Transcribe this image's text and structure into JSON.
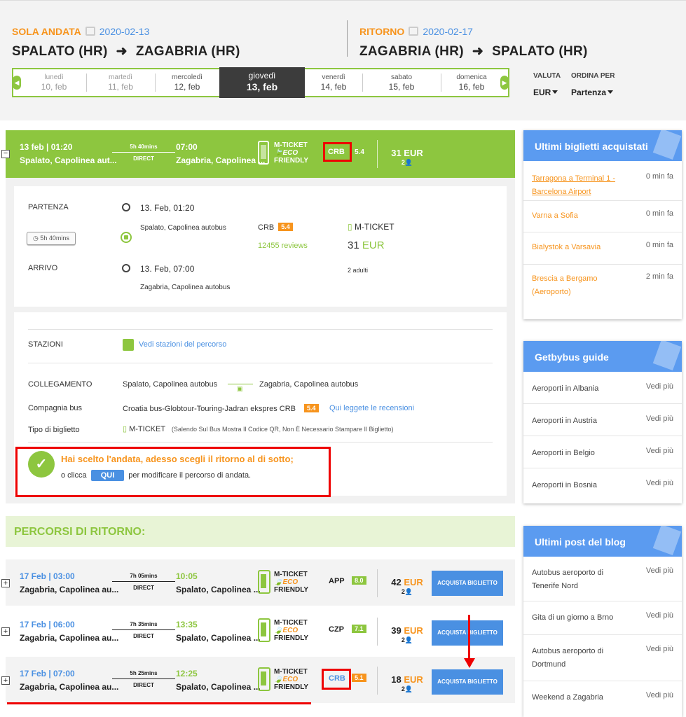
{
  "header": {
    "outbound": {
      "label": "SOLA ANDATA",
      "date": "2020-02-13",
      "from": "SPALATO (HR)",
      "to": "ZAGABRIA (HR)"
    },
    "return": {
      "label": "RITORNO",
      "date": "2020-02-17",
      "from": "ZAGABRIA (HR)",
      "to": "SPALATO (HR)"
    },
    "arrow": "➜",
    "days": [
      {
        "name": "lunedì",
        "date": "10, feb"
      },
      {
        "name": "martedì",
        "date": "11, feb"
      },
      {
        "name": "mercoledì",
        "date": "12, feb"
      },
      {
        "name": "giovedì",
        "date": "13, feb"
      },
      {
        "name": "venerdì",
        "date": "14, feb"
      },
      {
        "name": "sabato",
        "date": "15, feb"
      },
      {
        "name": "domenica",
        "date": "16, feb"
      }
    ],
    "currency": {
      "label": "VALUTA",
      "value": "EUR"
    },
    "sort": {
      "label": "ORDINA PER",
      "value": "Partenza"
    }
  },
  "selected": {
    "dep": "13 feb | 01:20",
    "dep_station": "Spalato, Capolinea aut...",
    "duration": "5h 40mins",
    "type": "DIRECT",
    "arr": "07:00",
    "arr_station": "Zagabria, Capolinea ...",
    "ticket": "M-TICKET",
    "eco": "ECO",
    "friendly": "FRIENDLY",
    "company": "CRB",
    "rating": "5.4",
    "price": "31 EUR",
    "pax": "2",
    "collapse": "−"
  },
  "detail": {
    "departure_label": "PARTENZA",
    "departure_time": "13. Feb, 01:20",
    "departure_station": "Spalato, Capolinea autobus",
    "duration": "5h 40mins",
    "arrival_label": "ARRIVO",
    "arrival_time": "13. Feb, 07:00",
    "arrival_station": "Zagabria, Capolinea autobus",
    "company": "CRB",
    "rating": "5.4",
    "reviews": "12455 reviews",
    "ticket": "M-TICKET",
    "price_num": "31",
    "price_cur": "EUR",
    "pax": "2 adulti"
  },
  "info": {
    "stations_label": "STAZIONI",
    "stations_link": "Vedi stazioni del percorso",
    "connection_label": "COLLEGAMENTO",
    "connection_from": "Spalato, Capolinea autobus",
    "connection_to": "Zagabria, Capolinea autobus",
    "company_label": "Compagnia bus",
    "company_value": "Croatia bus-Globtour-Touring-Jadran ekspres CRB",
    "company_rating": "5.4",
    "reviews_link": "Qui leggete le recensioni",
    "ticket_label": "Tipo di biglietto",
    "ticket_value": "M-TICKET",
    "ticket_note": "(Salendo Sul Bus Mostra Il Codice QR, Non È Necessario Stampare Il Biglietto)",
    "notice_title": "Hai scelto l'andata, adesso scegli il ritorno al di sotto;",
    "notice_pre": "o clicca",
    "notice_btn": "QUI",
    "notice_post": "per modificare il percorso di andata.",
    "check": "✓"
  },
  "returns_title": "PERCORSI DI RITORNO:",
  "returns": [
    {
      "dep": "17 Feb | 03:00",
      "dep_station": "Zagabria, Capolinea au...",
      "duration": "7h 05mins",
      "type": "DIRECT",
      "arr": "10:05",
      "arr_station": "Spalato, Capolinea ...",
      "company": "APP",
      "rating": "8.0",
      "price": "42",
      "cur": "EUR",
      "pax": "2",
      "buy": "ACQUISTA BIGLIETTO"
    },
    {
      "dep": "17 Feb | 06:00",
      "dep_station": "Zagabria, Capolinea au...",
      "duration": "7h 35mins",
      "type": "DIRECT",
      "arr": "13:35",
      "arr_station": "Spalato, Capolinea ...",
      "company": "CZP",
      "rating": "7.1",
      "price": "39",
      "cur": "EUR",
      "pax": "2",
      "buy": "ACQUISTA BIGLIETTO"
    },
    {
      "dep": "17 Feb | 07:00",
      "dep_station": "Zagabria, Capolinea au...",
      "duration": "5h 25mins",
      "type": "DIRECT",
      "arr": "12:25",
      "arr_station": "Spalato, Capolinea ...",
      "company": "CRB",
      "rating": "5.1",
      "price": "18",
      "cur": "EUR",
      "pax": "2",
      "buy": "ACQUISTA BIGLIETTO"
    }
  ],
  "row_common": {
    "ticket": "M-TICKET",
    "eco": "ECO",
    "friendly": "FRIENDLY",
    "expand": "+"
  },
  "sidebar": {
    "recent": {
      "title": "Ultimi biglietti acquistati",
      "items": [
        {
          "route": "Tarragona a Terminal 1 - Barcelona Airport",
          "time": "0 min fa"
        },
        {
          "route": "Varna a Sofia",
          "time": "0 min fa"
        },
        {
          "route": "Bialystok a Varsavia",
          "time": "0 min fa"
        },
        {
          "route": "Brescia a Bergamo (Aeroporto)",
          "time": "2 min fa"
        }
      ]
    },
    "guide": {
      "title": "Getbybus guide",
      "items": [
        {
          "label": "Aeroporti in Albania",
          "link": "Vedi più"
        },
        {
          "label": "Aeroporti in Austria",
          "link": "Vedi più"
        },
        {
          "label": "Aeroporti in Belgio",
          "link": "Vedi più"
        },
        {
          "label": "Aeroporti in Bosnia",
          "link": "Vedi più"
        }
      ]
    },
    "blog": {
      "title": "Ultimi post del blog",
      "items": [
        {
          "label": "Autobus aeroporto di Tenerife Nord",
          "link": "Vedi più"
        },
        {
          "label": "Gita di un giorno a Brno",
          "link": "Vedi più"
        },
        {
          "label": "Autobus aeroporto di Dortmund",
          "link": "Vedi più"
        },
        {
          "label": "Weekend a Zagabria",
          "link": "Vedi più"
        }
      ]
    }
  },
  "colors": {
    "green": "#8dc63f",
    "orange": "#f7941d",
    "blue": "#4a90e2",
    "annotation_red": "#e00000"
  }
}
